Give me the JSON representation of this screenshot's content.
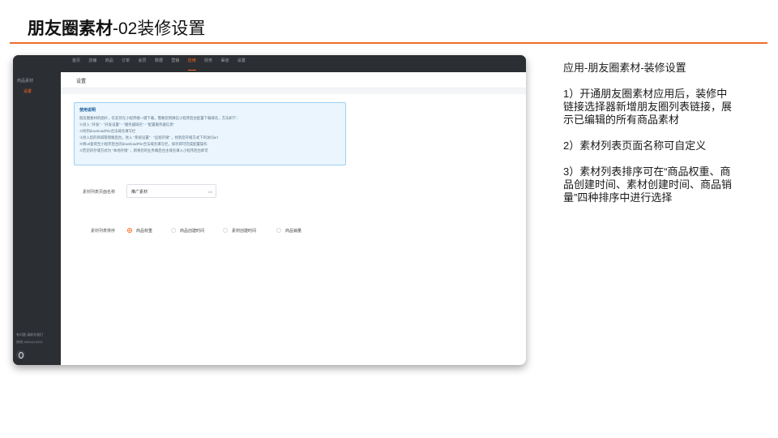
{
  "slide": {
    "title_bold": "朋友圈素材",
    "title_rest": "-02装修设置"
  },
  "app": {
    "nav": [
      "首页",
      "店铺",
      "商品",
      "订单",
      "会员",
      "数据",
      "营销",
      "应用",
      "财务",
      "渠道",
      "设置"
    ],
    "nav_active_index": 7,
    "sidebar": {
      "heading": "商品素材",
      "active_item": "设置",
      "footer_line1": "有问题,请联系我们",
      "footer_line2": "热线:18511112222"
    },
    "page_title": "设置",
    "notice": {
      "title": "使用说明",
      "lines": [
        "朋友圈素材的图片，仅支持在小程序端一键下载，需要您到微信小程序后台配置下载域名，方法如下：",
        "①进入 \"开发\" - \"开发设置\" - \"服务器域名\" - \"配置服务器信息\"",
        "②找到downloadFile合法域名填写栏",
        "③进入您的商城管理端后台，进入 \"系统设置\" - \"远程存储\" ，找到您存储方式下的访问url",
        "④将url复制至小程序后台的downloadFile合法域名填写栏，保存即可完成配置操作",
        "⑤若您的存储方式为 \"本地存储\" ，则将您的业务端后台主域名填入小程序后台即可"
      ]
    },
    "form": {
      "name_label": "素材列表页面名称",
      "name_value": "推广素材",
      "name_count": "4/8",
      "sort_label": "素材列表排序",
      "sort_options": [
        "商品权重",
        "商品创建时间",
        "素材创建时间",
        "商品销量"
      ],
      "sort_selected_index": 0
    }
  },
  "description": {
    "heading": "应用-朋友圈素材-装修设置",
    "point1": "1）开通朋友圈素材应用后，装修中链接选择器新增朋友圈列表链接，展示已编辑的所有商品素材",
    "point2": "2）素材列表页面名称可自定义",
    "point3": "3）素材列表排序可在“商品权重、商品创建时间、素材创建时间、商品销量”四种排序中进行选择"
  },
  "colors": {
    "accent": "#ff6a1a",
    "title_rule": "#ee6e2c",
    "dark_chrome": "#2b2e33",
    "notice_bg": "#eaf5fd",
    "notice_border": "#9fd0f2"
  }
}
